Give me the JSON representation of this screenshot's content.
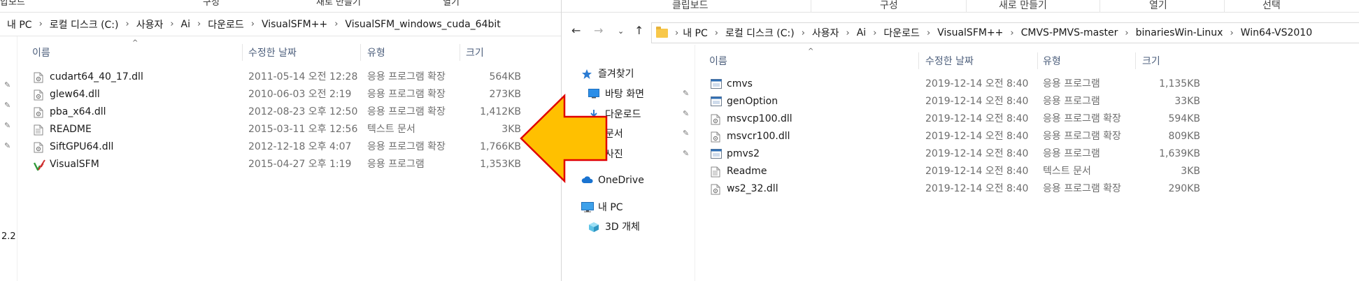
{
  "left": {
    "ribbon": [
      "압보드",
      "구성",
      "새로 만들기",
      "열기"
    ],
    "breadcrumb": [
      "내 PC",
      "로컬 디스크 (C:)",
      "사용자",
      "Ai",
      "다운로드",
      "VisualSFM++",
      "VisualSFM_windows_cuda_64bit"
    ],
    "columns": {
      "name": "이름",
      "date": "수정한 날짜",
      "type": "유형",
      "size": "크기"
    },
    "files": [
      {
        "name": "cudart64_40_17.dll",
        "date": "2011-05-14 오전 12:28",
        "type": "응용 프로그램 확장",
        "size": "564KB",
        "icon": "dll-icon"
      },
      {
        "name": "glew64.dll",
        "date": "2010-06-03 오전 2:19",
        "type": "응용 프로그램 확장",
        "size": "273KB",
        "icon": "dll-icon"
      },
      {
        "name": "pba_x64.dll",
        "date": "2012-08-23 오후 12:50",
        "type": "응용 프로그램 확장",
        "size": "1,412KB",
        "icon": "dll-icon"
      },
      {
        "name": "README",
        "date": "2015-03-11 오후 12:56",
        "type": "텍스트 문서",
        "size": "3KB",
        "icon": "text-file-icon"
      },
      {
        "name": "SiftGPU64.dll",
        "date": "2012-12-18 오후 4:07",
        "type": "응용 프로그램 확장",
        "size": "1,766KB",
        "icon": "dll-icon"
      },
      {
        "name": "VisualSFM",
        "date": "2015-04-27 오후 1:19",
        "type": "응용 프로그램",
        "size": "1,353KB",
        "icon": "visualsfm-app-icon"
      }
    ],
    "side_marker": "2.2"
  },
  "right": {
    "ribbon": [
      "클립보드",
      "구성",
      "새로 만들기",
      "열기",
      "선택"
    ],
    "breadcrumb": [
      "내 PC",
      "로컬 디스크 (C:)",
      "사용자",
      "Ai",
      "다운로드",
      "VisualSFM++",
      "CMVS-PMVS-master",
      "binariesWin-Linux",
      "Win64-VS2010"
    ],
    "nav_tree": [
      {
        "label": "즐겨찾기",
        "icon": "star-icon",
        "pinned": false
      },
      {
        "label": "바탕 화면",
        "icon": "desktop-icon",
        "pinned": true
      },
      {
        "label": "다운로드",
        "icon": "download-icon",
        "pinned": true
      },
      {
        "label": "문서",
        "icon": "document-icon",
        "pinned": true
      },
      {
        "label": "사진",
        "icon": "pictures-icon",
        "pinned": true
      },
      {
        "label": "OneDrive",
        "icon": "onedrive-icon",
        "pinned": false
      },
      {
        "label": "내 PC",
        "icon": "this-pc-icon",
        "pinned": false
      },
      {
        "label": "3D 개체",
        "icon": "3d-objects-icon",
        "pinned": false
      }
    ],
    "columns": {
      "name": "이름",
      "date": "수정한 날짜",
      "type": "유형",
      "size": "크기"
    },
    "files": [
      {
        "name": "cmvs",
        "date": "2019-12-14 오전 8:40",
        "type": "응용 프로그램",
        "size": "1,135KB",
        "icon": "exe-icon"
      },
      {
        "name": "genOption",
        "date": "2019-12-14 오전 8:40",
        "type": "응용 프로그램",
        "size": "33KB",
        "icon": "exe-icon"
      },
      {
        "name": "msvcp100.dll",
        "date": "2019-12-14 오전 8:40",
        "type": "응용 프로그램 확장",
        "size": "594KB",
        "icon": "dll-icon"
      },
      {
        "name": "msvcr100.dll",
        "date": "2019-12-14 오전 8:40",
        "type": "응용 프로그램 확장",
        "size": "809KB",
        "icon": "dll-icon"
      },
      {
        "name": "pmvs2",
        "date": "2019-12-14 오전 8:40",
        "type": "응용 프로그램",
        "size": "1,639KB",
        "icon": "exe-icon"
      },
      {
        "name": "Readme",
        "date": "2019-12-14 오전 8:40",
        "type": "텍스트 문서",
        "size": "3KB",
        "icon": "text-file-icon"
      },
      {
        "name": "ws2_32.dll",
        "date": "2019-12-14 오전 8:40",
        "type": "응용 프로그램 확장",
        "size": "290KB",
        "icon": "dll-icon"
      }
    ]
  },
  "colors": {
    "arrow_fill": "#FFC000",
    "arrow_stroke": "#E00000",
    "header_text": "#4D5F7C",
    "meta_text": "#6D6D6D",
    "folder": "#F8C84A"
  }
}
